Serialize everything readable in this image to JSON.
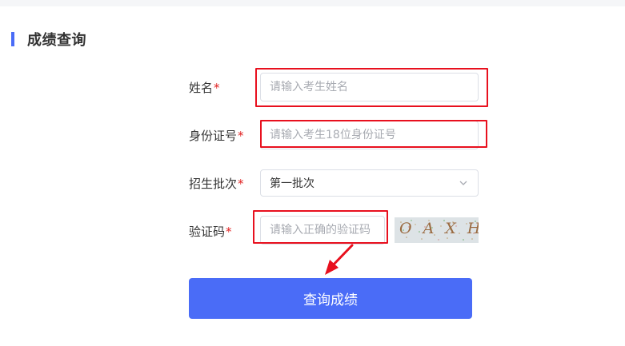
{
  "section": {
    "title": "成绩查询"
  },
  "form": {
    "name": {
      "label": "姓名",
      "required_mark": "*",
      "placeholder": "请输入考生姓名",
      "value": ""
    },
    "id_number": {
      "label": "身份证号",
      "required_mark": "*",
      "placeholder": "请输入考生18位身份证号",
      "value": ""
    },
    "batch": {
      "label": "招生批次",
      "required_mark": "*",
      "selected": "第一批次"
    },
    "captcha": {
      "label": "验证码",
      "required_mark": "*",
      "placeholder": "请输入正确的验证码",
      "value": "",
      "image_text": "OAXH"
    }
  },
  "submit": {
    "label": "查询成绩"
  },
  "colors": {
    "accent": "#4a6cf7",
    "highlight": "#e8101e",
    "required": "#e02020"
  }
}
